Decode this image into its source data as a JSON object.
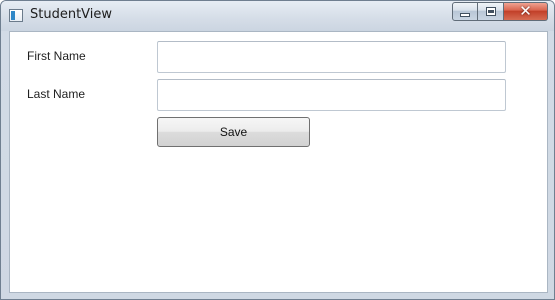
{
  "window": {
    "title": "StudentView"
  },
  "titlebar": {
    "icon": "window-app-icon",
    "controls": [
      {
        "name": "minimize",
        "icon": "minimize-icon"
      },
      {
        "name": "maximize",
        "icon": "maximize-icon"
      },
      {
        "name": "close",
        "icon": "close-icon",
        "glyph": "✕"
      }
    ]
  },
  "form": {
    "first_name_label": "First Name",
    "first_name_value": "",
    "last_name_label": "Last Name",
    "last_name_value": "",
    "save_label": "Save"
  }
}
